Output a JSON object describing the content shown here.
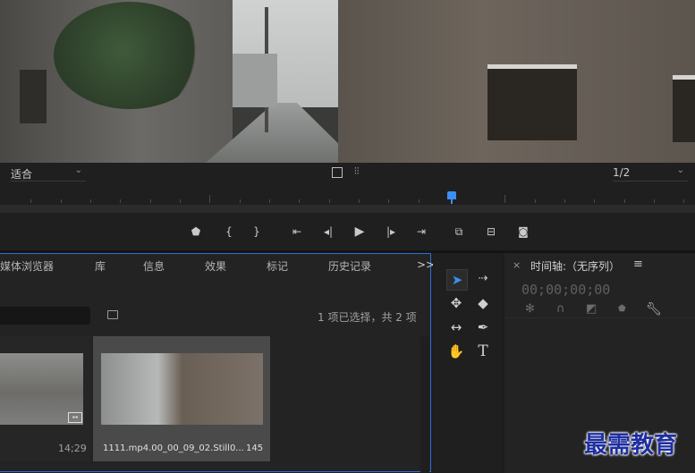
{
  "monitor": {
    "fit_dropdown": "适合",
    "resolution_dropdown": "1/2"
  },
  "project_panel": {
    "tabs": [
      "媒体浏览器",
      "库",
      "信息",
      "效果",
      "标记",
      "历史记录"
    ],
    "overflow_icon": ">>",
    "selection_status": "1 项已选择，共 2 项",
    "items": [
      {
        "duration": "14;29"
      },
      {
        "name": "1111.mp4.00_00_09_02.Still0...",
        "duration": "145"
      }
    ]
  },
  "timeline_panel": {
    "close_icon": "×",
    "title": "时间轴:（无序列）",
    "menu_icon": "≡",
    "timecode": "00;00;00;00"
  },
  "watermark": "最需教育",
  "colors": {
    "accent_blue": "#2d6fd6",
    "playhead": "#3b8ff2",
    "panel_bg": "#232323"
  }
}
